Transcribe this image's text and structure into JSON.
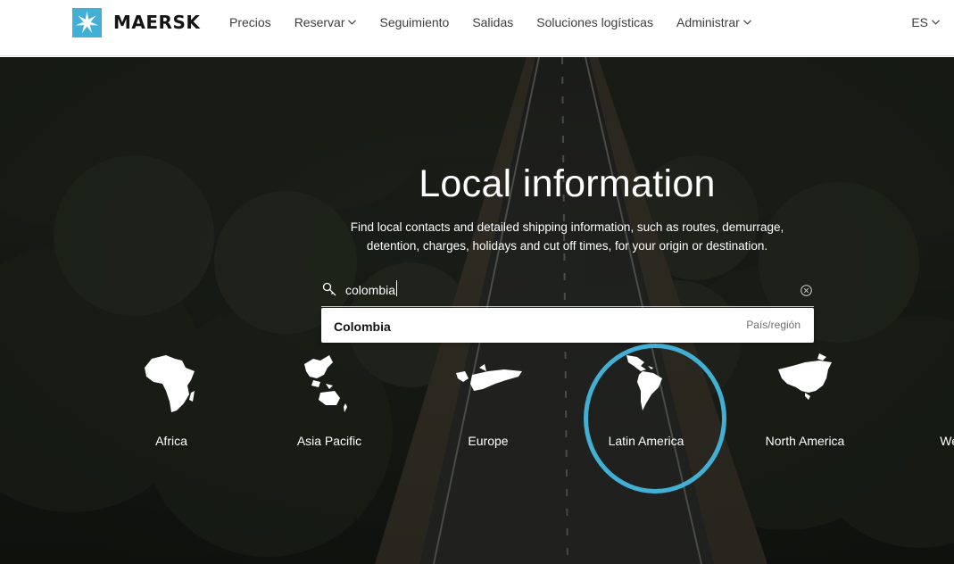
{
  "header": {
    "brand": "MAERSK",
    "nav": [
      {
        "label": "Precios",
        "has_dropdown": false
      },
      {
        "label": "Reservar",
        "has_dropdown": true
      },
      {
        "label": "Seguimiento",
        "has_dropdown": false
      },
      {
        "label": "Salidas",
        "has_dropdown": false
      },
      {
        "label": "Soluciones logísticas",
        "has_dropdown": false
      },
      {
        "label": "Administrar",
        "has_dropdown": true
      }
    ],
    "language": "ES"
  },
  "hero": {
    "title": "Local information",
    "subtitle": "Find local contacts and detailed shipping information, such as routes, demurrage, detention, charges, holidays and cut off times, for your origin or destination."
  },
  "search": {
    "value": "colombia",
    "suggestion": {
      "name": "Colombia",
      "type": "País/región"
    }
  },
  "regions": [
    {
      "label": "Africa",
      "icon": "africa-map-icon"
    },
    {
      "label": "Asia Pacific",
      "icon": "asia-pacific-map-icon"
    },
    {
      "label": "Europe",
      "icon": "europe-map-icon"
    },
    {
      "label": "Latin America",
      "icon": "latin-america-map-icon",
      "highlighted": true
    },
    {
      "label": "North America",
      "icon": "north-america-map-icon"
    },
    {
      "label": "West Co",
      "icon": "west-central-asia-map-icon"
    }
  ],
  "colors": {
    "brand": "#42b0d5",
    "highlight_ring": "#42b0d5",
    "nav_text": "#3c3c3c"
  }
}
